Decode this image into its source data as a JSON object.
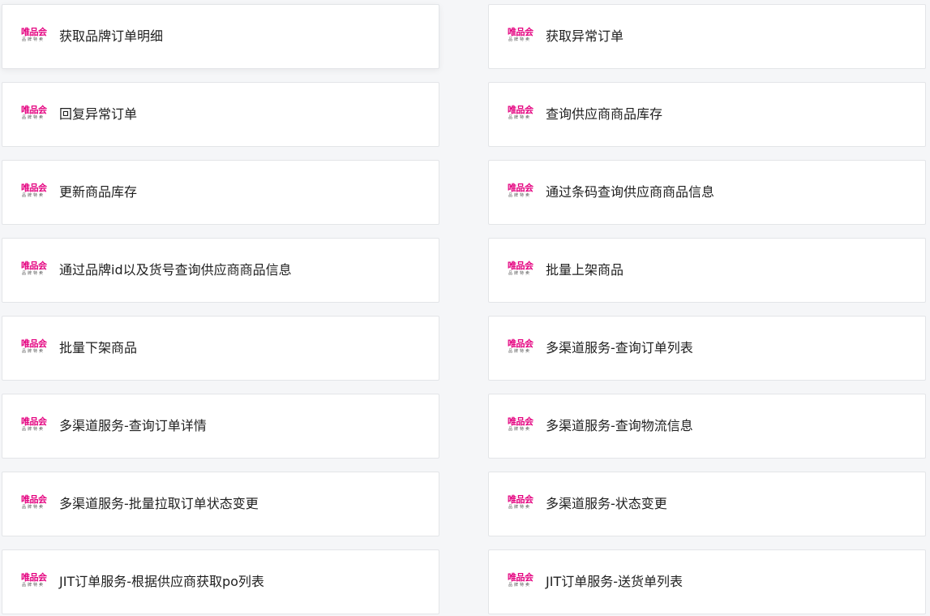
{
  "brand": {
    "logo_text": "唯品会",
    "logo_subtext": "品牌特卖",
    "logo_color": "#e4007f"
  },
  "api_list": [
    {
      "label": "获取品牌订单明细"
    },
    {
      "label": "获取异常订单"
    },
    {
      "label": "回复异常订单"
    },
    {
      "label": "查询供应商商品库存"
    },
    {
      "label": "更新商品库存"
    },
    {
      "label": "通过条码查询供应商商品信息"
    },
    {
      "label": "通过品牌id以及货号查询供应商商品信息"
    },
    {
      "label": "批量上架商品"
    },
    {
      "label": "批量下架商品"
    },
    {
      "label": "多渠道服务-查询订单列表"
    },
    {
      "label": "多渠道服务-查询订单详情"
    },
    {
      "label": "多渠道服务-查询物流信息"
    },
    {
      "label": "多渠道服务-批量拉取订单状态变更"
    },
    {
      "label": "多渠道服务-状态变更"
    },
    {
      "label": "JIT订单服务-根据供应商获取po列表"
    },
    {
      "label": "JIT订单服务-送货单列表"
    }
  ]
}
